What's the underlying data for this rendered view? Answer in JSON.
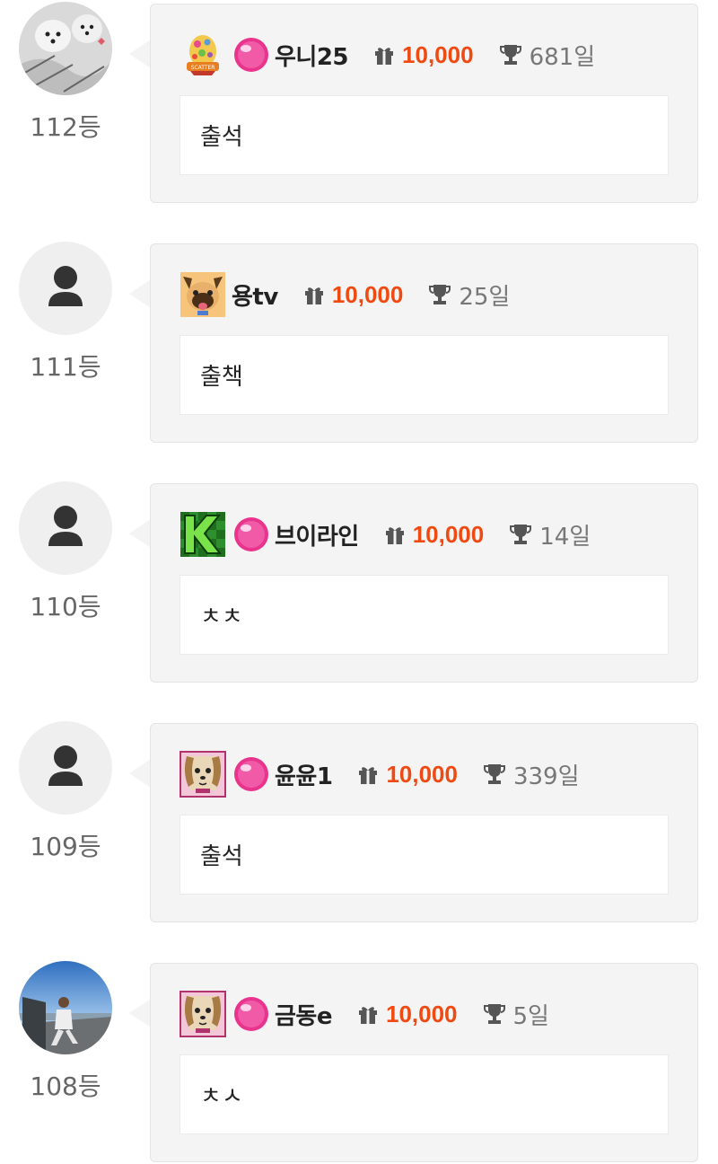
{
  "entries": [
    {
      "rank": "112등",
      "avatar": "photo-dogs",
      "badge": "egg-badge",
      "has_candy": true,
      "nickname": "우니25",
      "gift_amount": "10,000",
      "days": "681일",
      "message": "출석"
    },
    {
      "rank": "111등",
      "avatar": "default-user",
      "badge": "pug-badge",
      "has_candy": false,
      "nickname": "용tv",
      "gift_amount": "10,000",
      "days": "25일",
      "message": "출책"
    },
    {
      "rank": "110등",
      "avatar": "default-user",
      "badge": "k-badge",
      "has_candy": true,
      "nickname": "브이라인",
      "gift_amount": "10,000",
      "days": "14일",
      "message": "ㅊㅊ"
    },
    {
      "rank": "109등",
      "avatar": "default-user",
      "badge": "dog-badge",
      "has_candy": true,
      "nickname": "윤윤1",
      "gift_amount": "10,000",
      "days": "339일",
      "message": "출석"
    },
    {
      "rank": "108등",
      "avatar": "photo-person",
      "badge": "dog-badge",
      "has_candy": true,
      "nickname": "금동e",
      "gift_amount": "10,000",
      "days": "5일",
      "message": "ㅊㅅ"
    }
  ],
  "colors": {
    "accent": "#ef4a12",
    "card_bg": "#f4f4f4",
    "candy": "#e8348c"
  },
  "icons": {
    "gift": "gift-icon",
    "trophy": "trophy-icon",
    "candy": "candy-icon",
    "default_avatar": "user-silhouette-icon"
  }
}
